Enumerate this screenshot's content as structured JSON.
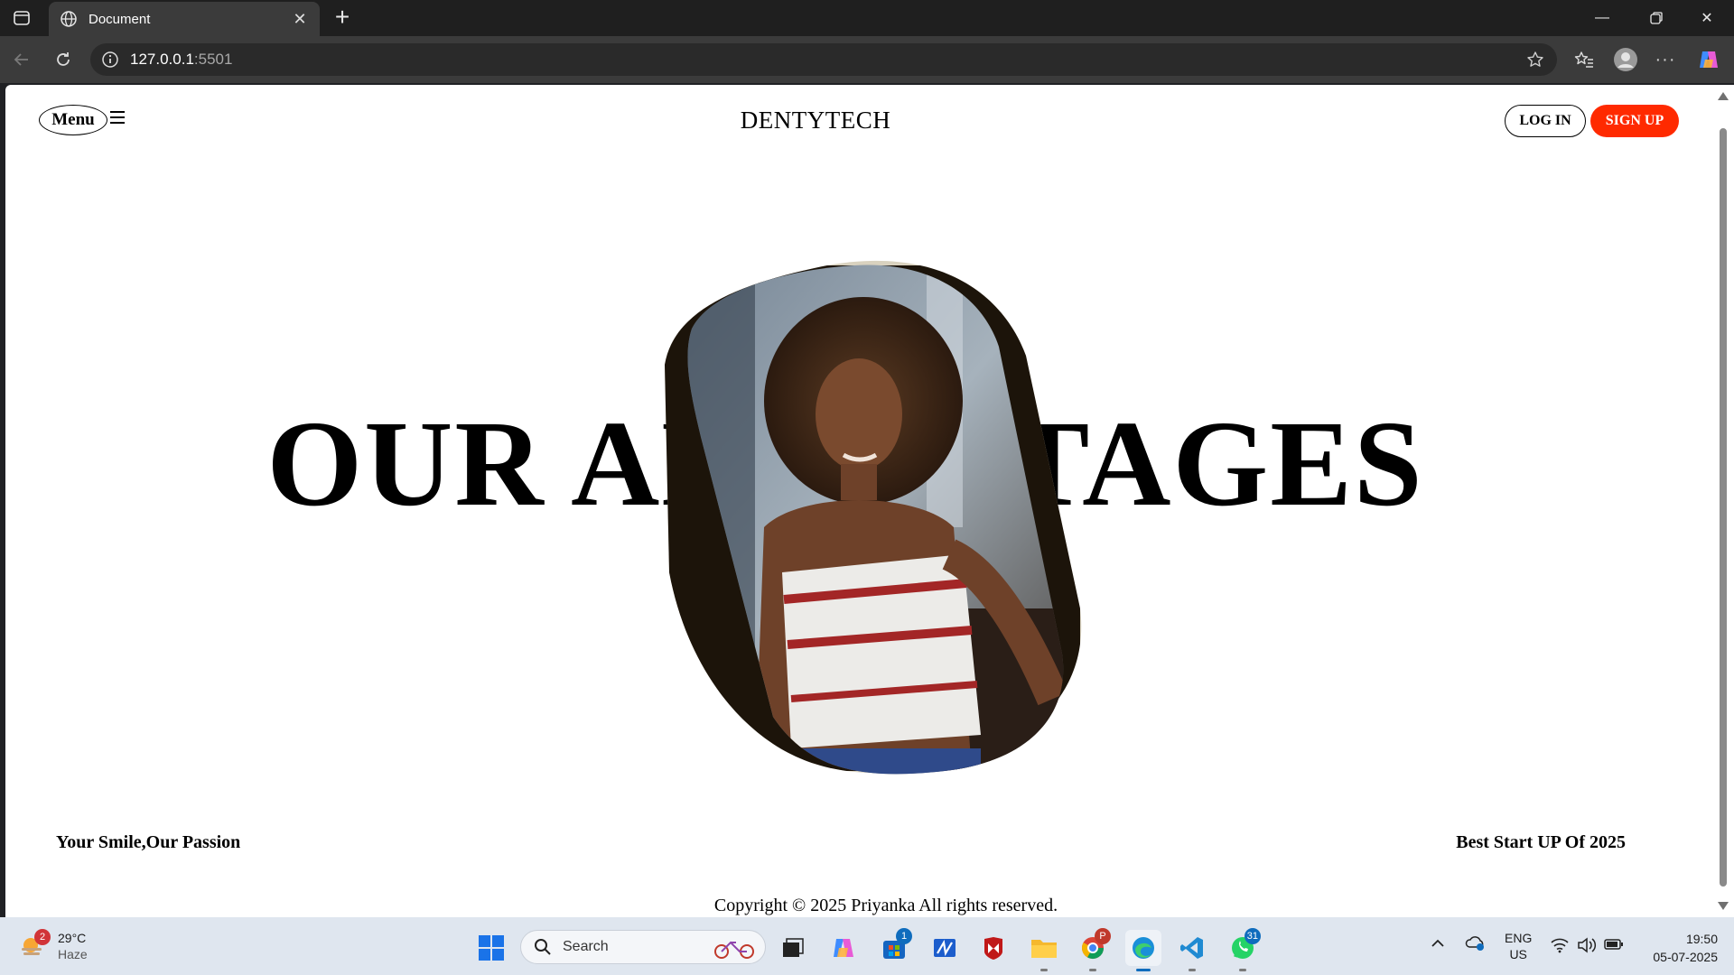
{
  "browser": {
    "tab_title": "Document",
    "url_host": "127.0.0.1",
    "url_port": ":5501"
  },
  "site": {
    "menu_label": "Menu",
    "brand": "DENTYTECH",
    "login_label": "LOG IN",
    "signup_label": "SIGN UP",
    "hero_title": "OUR ADVANTAGES",
    "tagline_left": "Your Smile,Our Passion",
    "tagline_right": "Best Start UP Of 2025",
    "copyright": "Copyright © 2025 Priyanka All rights reserved."
  },
  "colors": {
    "signup_bg": "#ff2a00",
    "chrome_dark": "#1f1f1f",
    "toolbar": "#3b3b3b",
    "taskbar": "#dfe6ef"
  },
  "taskbar": {
    "weather_temp": "29°C",
    "weather_desc": "Haze",
    "weather_badge": "2",
    "search_placeholder": "Search",
    "store_badge": "1",
    "whatsapp_badge": "31",
    "chrome_profile_badge": "P",
    "lang_top": "ENG",
    "lang_bottom": "US",
    "time": "19:50",
    "date": "05-07-2025"
  }
}
